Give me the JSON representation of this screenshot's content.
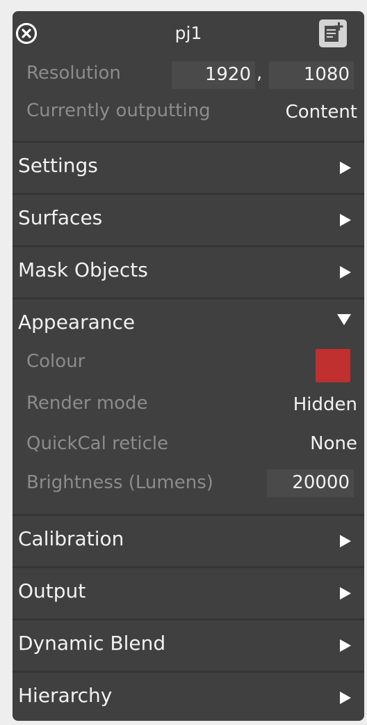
{
  "panel": {
    "title": "pj1",
    "resolution_label": "Resolution",
    "resolution_width": "1920",
    "resolution_comma": ",",
    "resolution_height": "1080",
    "outputting_label": "Currently outputting",
    "outputting_value": "Content"
  },
  "sections": {
    "settings": "Settings",
    "surfaces": "Surfaces",
    "mask_objects": "Mask Objects",
    "appearance": "Appearance",
    "calibration": "Calibration",
    "output": "Output",
    "dynamic_blend": "Dynamic Blend",
    "hierarchy": "Hierarchy"
  },
  "appearance": {
    "colour_label": "Colour",
    "colour_value": "#c0302f",
    "render_mode_label": "Render mode",
    "render_mode_value": "Hidden",
    "quickcal_label": "QuickCal reticle",
    "quickcal_value": "None",
    "brightness_label": "Brightness (Lumens)",
    "brightness_value": "20000"
  },
  "icons": {
    "close": "close-icon",
    "notes": "notes-add-icon",
    "collapsed_arrow": "triangle-right-icon",
    "expanded_arrow": "triangle-down-icon"
  }
}
